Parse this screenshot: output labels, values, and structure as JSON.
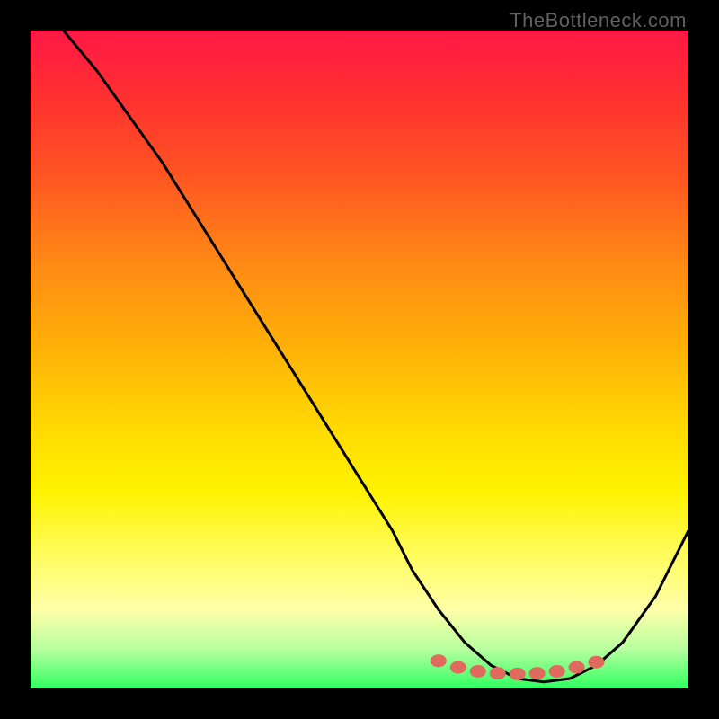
{
  "watermark": "TheBottleneck.com",
  "chart_data": {
    "type": "line",
    "title": "",
    "xlabel": "",
    "ylabel": "",
    "xlim": [
      0,
      100
    ],
    "ylim": [
      0,
      100
    ],
    "series": [
      {
        "name": "curve",
        "x": [
          5,
          10,
          15,
          20,
          25,
          30,
          35,
          40,
          45,
          50,
          55,
          58,
          62,
          66,
          70,
          74,
          78,
          82,
          86,
          90,
          95,
          100
        ],
        "y": [
          100,
          94,
          87,
          80,
          72,
          64,
          56,
          48,
          40,
          32,
          24,
          18,
          12,
          7,
          3.5,
          1.5,
          1,
          1.5,
          3.5,
          7,
          14,
          24
        ]
      }
    ],
    "markers": {
      "name": "highlight-dots",
      "x": [
        62,
        65,
        68,
        71,
        74,
        77,
        80,
        83,
        86
      ],
      "y": [
        4.2,
        3.2,
        2.6,
        2.3,
        2.2,
        2.3,
        2.6,
        3.2,
        4.0
      ]
    },
    "colors": {
      "curve": "#000000",
      "markers": "#e06a5e",
      "gradient_top": "#ff1846",
      "gradient_bottom": "#30ff60"
    }
  }
}
